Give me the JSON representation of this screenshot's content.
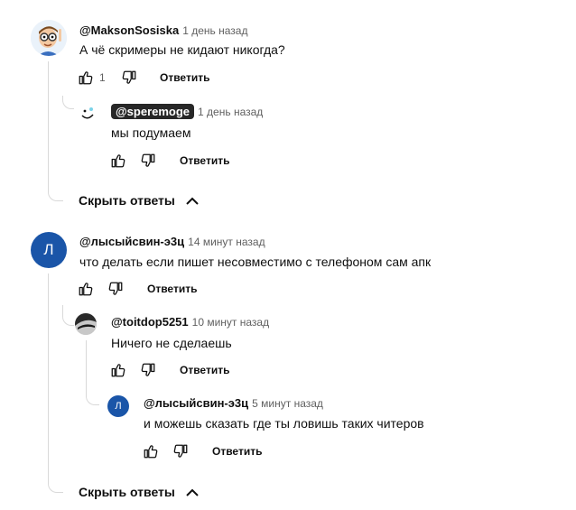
{
  "thread1": {
    "comment": {
      "author": "@MaksonSosiska",
      "time": "1 день назад",
      "text": "А чё скримеры не кидают никогда?",
      "likes": "1",
      "reply_label": "Ответить"
    },
    "replies": [
      {
        "author": "@speremoge",
        "time": "1 день назад",
        "text": "мы подумаем",
        "reply_label": "Ответить"
      }
    ],
    "toggle_label": "Скрыть ответы"
  },
  "thread2": {
    "comment": {
      "author": "@лысыйсвин-э3ц",
      "avatar_letter": "Л",
      "time": "14 минут назад",
      "text": "что делать если пишет несовместимо с телефоном сам апк",
      "reply_label": "Ответить"
    },
    "replies": [
      {
        "author": "@toitdop5251",
        "time": "10 минут назад",
        "text": "Ничего не сделаешь",
        "reply_label": "Ответить"
      },
      {
        "author": "@лысыйсвин-э3ц",
        "avatar_letter": "Л",
        "time": "5 минут назад",
        "text": "и можешь сказать где ты ловишь таких читеров",
        "reply_label": "Ответить"
      }
    ],
    "toggle_label": "Скрыть ответы"
  },
  "colors": {
    "avatar_blue": "#1a55a8",
    "badge_bg": "#272727",
    "thread_line": "#d9d9d9"
  },
  "icons": [
    "thumb-up-icon",
    "thumb-down-icon",
    "chevron-up-icon"
  ]
}
